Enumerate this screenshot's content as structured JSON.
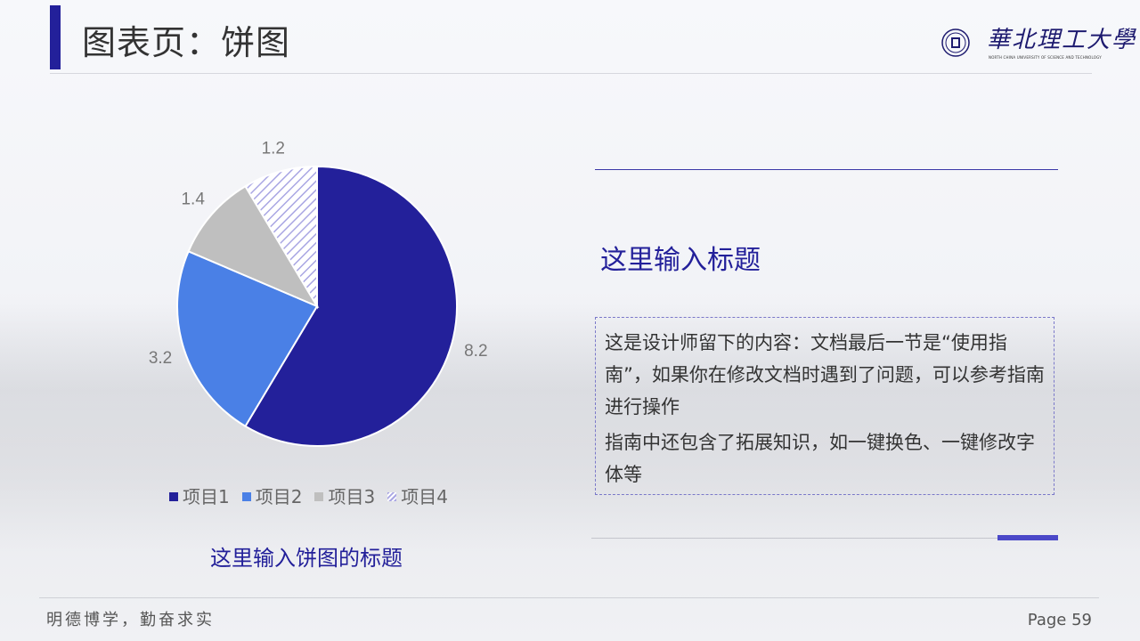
{
  "header": {
    "title": "图表页：饼图",
    "logo_text": "華北理工大學",
    "logo_subtext": "NORTH CHINA UNIVERSITY OF SCIENCE AND TECHNOLOGY"
  },
  "chart_data": {
    "type": "pie",
    "categories": [
      "项目1",
      "项目2",
      "项目3",
      "项目4"
    ],
    "values": [
      8.2,
      3.2,
      1.4,
      1.2
    ],
    "colors": [
      "#23209a",
      "#4a80e6",
      "#bfbfbf",
      "#c8c6ee"
    ],
    "legend_position": "bottom",
    "data_labels": [
      "8.2",
      "3.2",
      "1.4",
      "1.2"
    ]
  },
  "chart_caption": "这里输入饼图的标题",
  "right_panel": {
    "title": "这里输入标题",
    "paragraph1": "这是设计师留下的内容：文档最后一节是“使用指南”，如果你在修改文档时遇到了问题，可以参考指南进行操作",
    "paragraph2": "指南中还包含了拓展知识，如一键换色、一键修改字体等"
  },
  "footer": {
    "motto": "明德博学，勤奋求实",
    "page": "Page 59"
  }
}
